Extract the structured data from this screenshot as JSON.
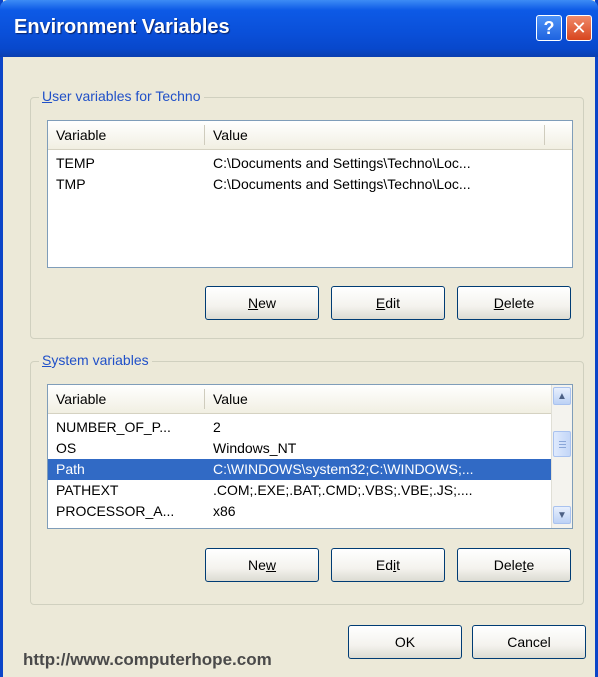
{
  "window": {
    "title": "Environment Variables",
    "help_label": "?",
    "close_label": "✕"
  },
  "user_group": {
    "legend_prefix": "U",
    "legend_rest": "ser variables for Techno",
    "columns": [
      "Variable",
      "Value"
    ],
    "rows": [
      {
        "variable": "TEMP",
        "value": "C:\\Documents and Settings\\Techno\\Loc...",
        "selected": false
      },
      {
        "variable": "TMP",
        "value": "C:\\Documents and Settings\\Techno\\Loc...",
        "selected": false
      }
    ],
    "buttons": {
      "new": {
        "mnemonic": "N",
        "rest": "ew"
      },
      "edit": {
        "mnemonic": "E",
        "rest": "dit"
      },
      "delete": {
        "mnemonic": "D",
        "rest": "elete"
      }
    }
  },
  "system_group": {
    "legend_prefix": "S",
    "legend_rest": "ystem variables",
    "columns": [
      "Variable",
      "Value"
    ],
    "rows": [
      {
        "variable": "NUMBER_OF_P...",
        "value": "2",
        "selected": false
      },
      {
        "variable": "OS",
        "value": "Windows_NT",
        "selected": false
      },
      {
        "variable": "Path",
        "value": "C:\\WINDOWS\\system32;C:\\WINDOWS;...",
        "selected": true
      },
      {
        "variable": "PATHEXT",
        "value": ".COM;.EXE;.BAT;.CMD;.VBS;.VBE;.JS;....",
        "selected": false
      },
      {
        "variable": "PROCESSOR_A...",
        "value": "x86",
        "selected": false
      }
    ],
    "buttons": {
      "new": {
        "before": "Ne",
        "mnemonic": "w",
        "after": ""
      },
      "edit": {
        "before": "Ed",
        "mnemonic": "i",
        "after": "t"
      },
      "delete": {
        "before": "Dele",
        "mnemonic": "t",
        "after": "e"
      }
    }
  },
  "dialog_buttons": {
    "ok": "OK",
    "cancel": "Cancel"
  },
  "watermark": "http://www.computerhope.com",
  "colors": {
    "titlebar": "#0a4fd8",
    "selection": "#316ac5",
    "legend_text": "#2050c8",
    "dialog_bg": "#ece9d8"
  },
  "icons": {
    "scroll_up": "chevron-up-icon",
    "scroll_down": "chevron-down-icon"
  }
}
